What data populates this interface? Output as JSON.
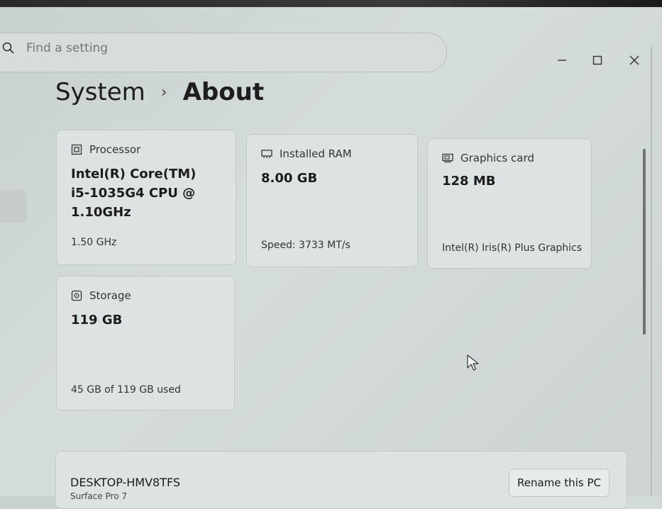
{
  "search": {
    "placeholder": "Find a setting"
  },
  "breadcrumb": {
    "parent": "System",
    "separator": "›",
    "current": "About"
  },
  "specs": {
    "processor": {
      "label": "Processor",
      "value_lines": [
        "Intel(R) Core(TM)",
        "i5-1035G4 CPU @",
        "1.10GHz"
      ],
      "sub": "1.50 GHz"
    },
    "ram": {
      "label": "Installed RAM",
      "value": "8.00 GB",
      "sub": "Speed: 3733 MT/s"
    },
    "graphics": {
      "label": "Graphics card",
      "value": "128 MB",
      "sub": "Intel(R) Iris(R) Plus Graphics"
    },
    "storage": {
      "label": "Storage",
      "value": "119 GB",
      "sub": "45 GB of 119 GB used"
    }
  },
  "device": {
    "name": "DESKTOP-HMV8TFS",
    "model": "Surface Pro 7",
    "rename_label": "Rename this PC"
  },
  "icons": {
    "search": "search-icon",
    "processor": "processor-icon",
    "ram": "ram-icon",
    "graphics": "graphics-card-icon",
    "storage": "storage-icon",
    "minimize": "minimize-icon",
    "maximize": "maximize-icon",
    "close": "close-icon",
    "cursor": "mouse-cursor-icon"
  }
}
